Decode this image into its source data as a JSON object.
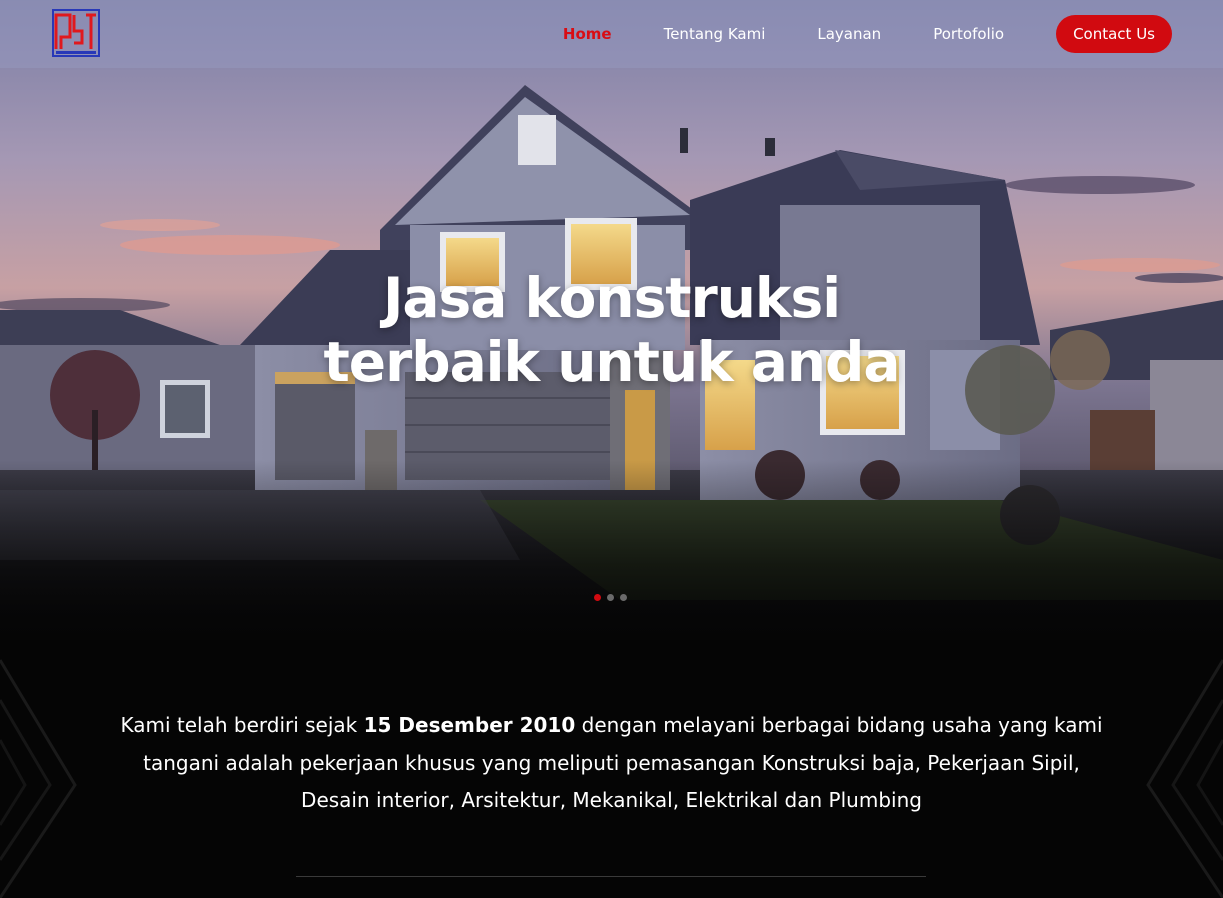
{
  "nav": {
    "logo_icon": "ast-logo-icon",
    "items": [
      {
        "label": "Home",
        "active": true
      },
      {
        "label": "Tentang Kami",
        "active": false
      },
      {
        "label": "Layanan",
        "active": false
      },
      {
        "label": "Portofolio",
        "active": false
      }
    ],
    "contact_label": "Contact Us"
  },
  "hero": {
    "headline_line1": "Jasa konstruksi",
    "headline_line2": "terbaik untuk anda",
    "slides_total": 3,
    "active_slide": 1
  },
  "about": {
    "text_before": "Kami telah berdiri sejak ",
    "date_highlight": "15 Desember 2010",
    "text_after": " dengan melayani berbagai bidang usaha yang kami tangani adalah pekerjaan khusus yang meliputi pemasangan Konstruksi baja, Pekerjaan Sipil, Desain interior, Arsitektur, Mekanikal, Elektrikal dan Plumbing"
  },
  "colors": {
    "accent": "#d10a10",
    "nav_bg": "#9698be",
    "section_bg": "#050505"
  }
}
